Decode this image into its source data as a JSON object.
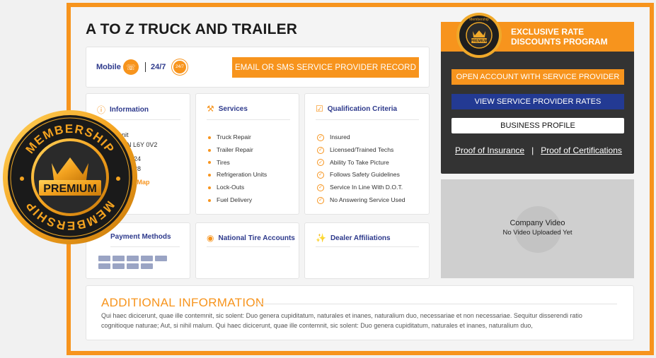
{
  "title": "A TO Z TRUCK AND TRAILER",
  "contact": {
    "mobile_label": "Mobile",
    "mobile_icon": "phone-icon",
    "hours_label": "24/7",
    "hours_badge": "24/7",
    "cta_label": "EMAIL OR SMS SERVICE PROVIDER RECORD"
  },
  "info": {
    "title": "Information",
    "line1": "nit",
    "line2": "ON L6Y 0V2",
    "line3": "924",
    "line4": "128",
    "map_link": "w Map"
  },
  "services": {
    "title": "Services",
    "items": [
      "Truck Repair",
      "Trailer Repair",
      "Tires",
      "Refrigeration Units",
      "Lock-Outs",
      "Fuel Delivery"
    ]
  },
  "qualification": {
    "title": "Qualification Criteria",
    "items": [
      "Insured",
      "Licensed/Trained Techs",
      "Ability To Take Picture",
      "Follows Safety Guidelines",
      "Service In Line With D.O.T.",
      "No Answering Service Used"
    ]
  },
  "payment": {
    "title": "Payment Methods"
  },
  "tires": {
    "title": "National Tire Accounts"
  },
  "dealer": {
    "title": "Dealer Affiliations"
  },
  "sidebar": {
    "title_line1": "EXCLUSIVE RATE",
    "title_line2": "DISCOUNTS PROGRAM",
    "open_account": "OPEN ACCOUNT WITH SERVICE PROVIDER",
    "view_rates": "VIEW SERVICE PROVIDER RATES",
    "business_profile": "BUSINESS PROFILE",
    "proof_insurance": "Proof of Insurance",
    "separator": "|",
    "proof_certs": "Proof of Certifications",
    "small_badge_top": "Membership",
    "small_badge_mid": "PREMIUM"
  },
  "video": {
    "title": "Company Video",
    "status": "No Video Uploaded Yet"
  },
  "additional": {
    "title": "ADDITIONAL INFORMATION",
    "text": "Qui haec dicicerunt, quae ille contemnit, sic solent: Duo genera cupiditatum, naturales et inanes, naturalium duo, necessariae et non necessariae. Sequitur disserendi ratio cognitioque naturae; Aut, si nihil malum. Qui haec dicicerunt, quae ille contemnit, sic solent: Duo genera cupiditatum, naturales et inanes, naturalium duo,"
  },
  "badge": {
    "top": "MEMBERSHIP",
    "middle": "PREMIUM",
    "bottom": "MEMBERSHIP"
  },
  "colors": {
    "accent": "#f7941d",
    "navy": "#2e3a8c",
    "dark_panel": "#333333",
    "blue_button": "#233a93"
  }
}
